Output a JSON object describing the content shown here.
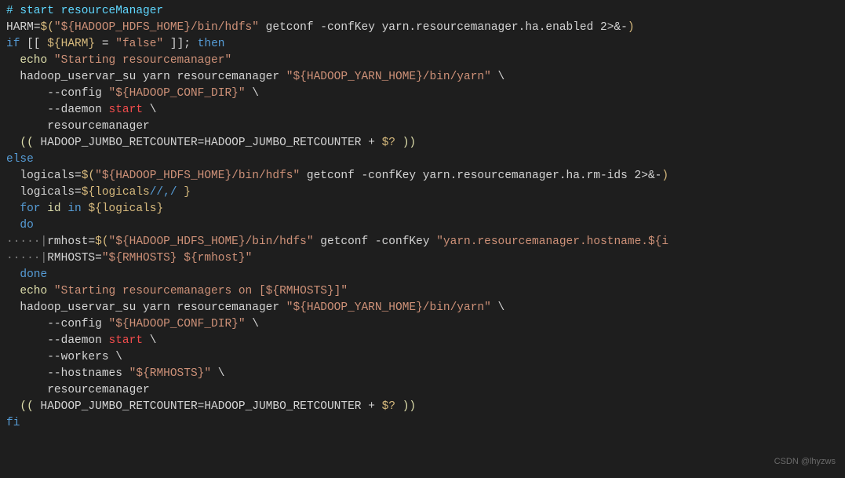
{
  "watermark": "CSDN @lhyzws",
  "l01": {
    "a": "# start resourceManager"
  },
  "l02": {
    "a": "HARM",
    "b": "=",
    "c": "$(",
    "d": "\"${HADOOP_HDFS_HOME}/bin/hdfs\"",
    "e": " getconf -confKey yarn.resourcemanager.ha.enabled 2>&-",
    "f": ")"
  },
  "l03": {
    "a": "if",
    "b": " [[ ",
    "c": "${HARM}",
    "d": " = ",
    "e": "\"false\"",
    "f": " ]]; ",
    "g": "then"
  },
  "l04": {
    "a": "  ",
    "b": "echo",
    "c": " ",
    "d": "\"Starting resourcemanager\""
  },
  "l05": {
    "a": "  hadoop_uservar_su yarn resourcemanager ",
    "b": "\"${HADOOP_YARN_HOME}/bin/yarn\"",
    "c": " \\"
  },
  "l06": {
    "a": "      --config ",
    "b": "\"${HADOOP_CONF_DIR}\"",
    "c": " \\"
  },
  "l07": {
    "a": "      --daemon ",
    "b": "start",
    "c": " \\"
  },
  "l08": {
    "a": "      resourcemanager"
  },
  "l09": {
    "a": "  (( ",
    "b": "HADOOP_JUMBO_RETCOUNTER",
    "c": "=",
    "d": "HADOOP_JUMBO_RETCOUNTER",
    "e": " + ",
    "f": "$?",
    "g": " ))"
  },
  "l10": {
    "a": "else"
  },
  "l11": {
    "a": "  logicals",
    "b": "=",
    "c": "$(",
    "d": "\"${HADOOP_HDFS_HOME}/bin/hdfs\"",
    "e": " getconf -confKey yarn.resourcemanager.ha.rm-ids 2>&-",
    "f": ")"
  },
  "l12": {
    "a": "  logicals",
    "b": "=",
    "c": "${logicals",
    "d": "//,/",
    "e": " }"
  },
  "l13": {
    "a": "  ",
    "b": "for",
    "c": " ",
    "d": "id",
    "e": " ",
    "f": "in",
    "g": " ",
    "h": "${logicals}"
  },
  "l14": {
    "a": "  ",
    "b": "do"
  },
  "l15": {
    "arrow": "·····|",
    "a": "rmhost",
    "b": "=",
    "c": "$(",
    "d": "\"${HADOOP_HDFS_HOME}/bin/hdfs\"",
    "e": " getconf -confKey ",
    "f": "\"yarn.resourcemanager.hostname.${i",
    "g": ""
  },
  "l16": {
    "arrow": "·····|",
    "a": "RMHOSTS",
    "b": "=",
    "c": "\"${RMHOSTS} ${rmhost}\""
  },
  "l17": {
    "a": "  ",
    "b": "done"
  },
  "l18": {
    "a": "  ",
    "b": "echo",
    "c": " ",
    "d": "\"Starting resourcemanagers on [${RMHOSTS}]\""
  },
  "l19": {
    "a": "  hadoop_uservar_su yarn resourcemanager ",
    "b": "\"${HADOOP_YARN_HOME}/bin/yarn\"",
    "c": " \\"
  },
  "l20": {
    "a": "      --config ",
    "b": "\"${HADOOP_CONF_DIR}\"",
    "c": " \\"
  },
  "l21": {
    "a": "      --daemon ",
    "b": "start",
    "c": " \\"
  },
  "l22": {
    "a": "      --workers \\"
  },
  "l23": {
    "a": "      --hostnames ",
    "b": "\"${RMHOSTS}\"",
    "c": " \\"
  },
  "l24": {
    "a": "      resourcemanager"
  },
  "l25": {
    "a": "  (( ",
    "b": "HADOOP_JUMBO_RETCOUNTER",
    "c": "=",
    "d": "HADOOP_JUMBO_RETCOUNTER",
    "e": " + ",
    "f": "$?",
    "g": " ))"
  },
  "l26": {
    "a": "fi"
  }
}
